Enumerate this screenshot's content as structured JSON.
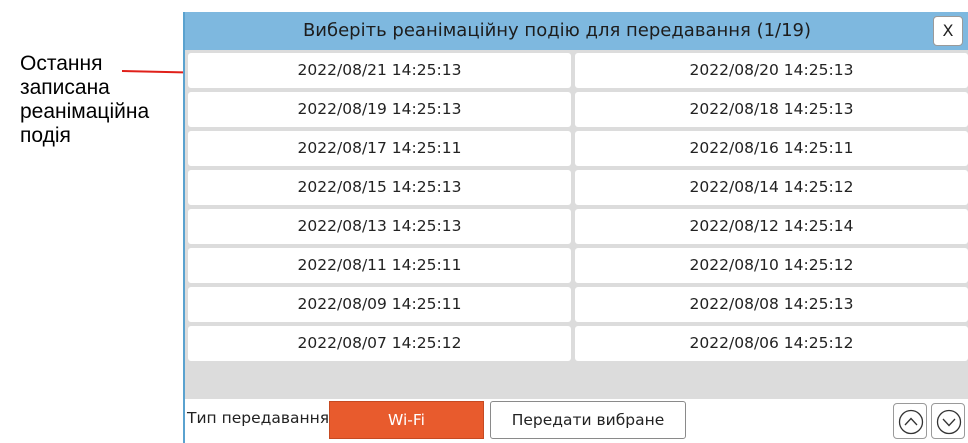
{
  "annotation": {
    "lines": [
      "Остання",
      "записана",
      "реанімаційна",
      "подія"
    ]
  },
  "dialog": {
    "title": "Виберіть реанімаційну подію для передавання (1/19)",
    "close_label": "X",
    "events": [
      "2022/08/21 14:25:13",
      "2022/08/20 14:25:13",
      "2022/08/19 14:25:13",
      "2022/08/18 14:25:13",
      "2022/08/17 14:25:11",
      "2022/08/16 14:25:11",
      "2022/08/15 14:25:13",
      "2022/08/14 14:25:12",
      "2022/08/13 14:25:13",
      "2022/08/12 14:25:14",
      "2022/08/11 14:25:11",
      "2022/08/10 14:25:12",
      "2022/08/09 14:25:11",
      "2022/08/08 14:25:13",
      "2022/08/07 14:25:12",
      "2022/08/06 14:25:12"
    ],
    "transfer_type_label": "Тип передавання",
    "wifi_label": "Wi-Fi",
    "send_selected_label": "Передати вибране",
    "page_up_icon": "chevron-up-circle-icon",
    "page_down_icon": "chevron-down-circle-icon"
  },
  "colors": {
    "title_bar": "#7eb8df",
    "wifi_button": "#e85b2d",
    "annotation_line": "#e0201a"
  }
}
